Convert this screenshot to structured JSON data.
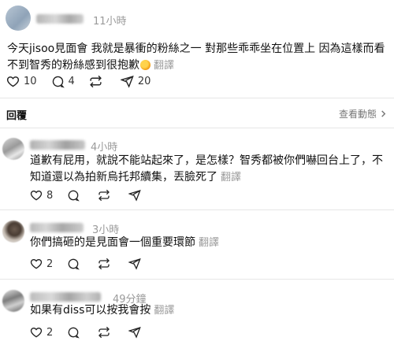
{
  "post": {
    "timestamp": "11小時",
    "text": "今天jisoo見面會 我就是暴衝的粉絲之一 對那些乖乖坐在位置上 因為這樣而看不到智秀的粉絲感到很抱歉",
    "translate_label": "翻譯",
    "likes": "10",
    "comments": "4",
    "shares": "20"
  },
  "view_activity_label": "查看動態",
  "replies_title": "回覆",
  "comments": [
    {
      "timestamp": "4小時",
      "text": "道歉有屁用，就說不能站起來了，是怎樣？智秀都被你們嚇回台上了，不知道還以為拍新烏托邦續集，丟臉死了",
      "translate_label": "翻譯",
      "likes": "8"
    },
    {
      "timestamp": "3小時",
      "text": "你們搞砸的是見面會一個重要環節",
      "translate_label": "翻譯",
      "likes": "2"
    },
    {
      "timestamp": "49分鐘",
      "text": "如果有diss可以按我會按",
      "translate_label": "翻譯",
      "likes": "2"
    }
  ],
  "icons": {
    "like": "heart-icon",
    "comment": "comment-bubble-icon",
    "repost": "repost-icon",
    "share": "send-icon",
    "chevron": "chevron-right-icon"
  }
}
